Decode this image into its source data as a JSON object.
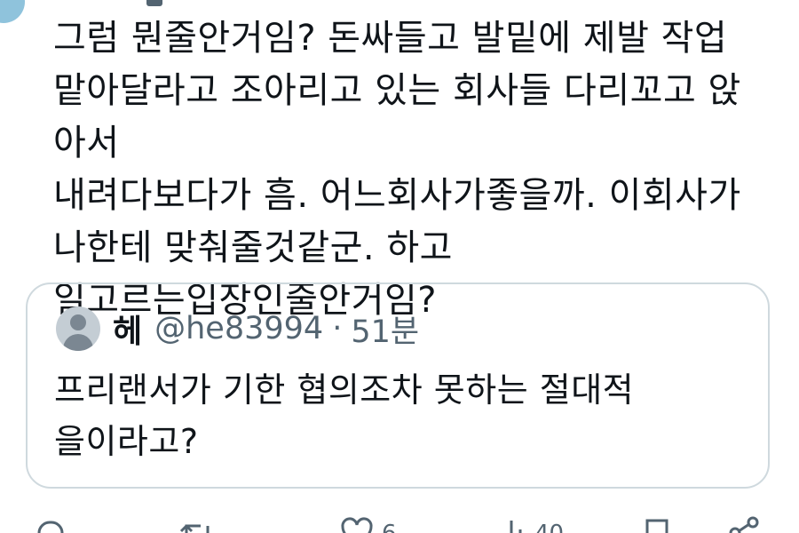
{
  "tweet": {
    "text": "그럼 뭔줄안거임? 돈싸들고 발밑에 제발 작업\n맡아달라고 조아리고 있는 회사들 다리꼬고 앉아서\n내려다보다가 흠. 어느회사가좋을까. 이회사가\n나한테 맞춰줄것같군. 하고\n일고르는입장인줄안거임?"
  },
  "quoted_tweet": {
    "name": "헤",
    "handle": "@he83994",
    "separator": "·",
    "time": "51분",
    "text": "프리랜서가 기한 협의조차 못하는 절대적\n을이라고?"
  },
  "actions": {
    "reply_icon": "reply-icon",
    "retweet_icon": "retweet-icon",
    "like_icon": "heart-icon",
    "like_count": "6",
    "views_icon": "views-icon",
    "views_count": "40",
    "bookmark_icon": "bookmark-icon",
    "share_icon": "share-icon"
  },
  "colors": {
    "text": "#0f1419",
    "muted": "#536471",
    "border": "#cfd9de",
    "background": "#ffffff"
  }
}
